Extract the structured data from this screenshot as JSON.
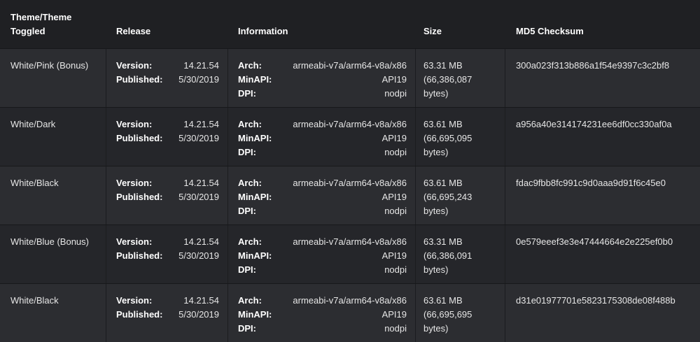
{
  "headers": {
    "theme": "Theme/Theme Toggled",
    "release": "Release",
    "information": "Information",
    "size": "Size",
    "md5": "MD5 Checksum"
  },
  "labels": {
    "version": "Version:",
    "published": "Published:",
    "arch": "Arch:",
    "minapi": "MinAPI:",
    "dpi": "DPI:"
  },
  "rows": [
    {
      "theme": "White/Pink (Bonus)",
      "version": "14.21.54",
      "published": "5/30/2019",
      "arch": "armeabi-v7a/arm64-v8a/x86",
      "minapi": "API19",
      "dpi": "nodpi",
      "size_mb": "63.31 MB",
      "size_bytes_1": "(66,386,087",
      "size_bytes_2": "bytes)",
      "md5": "300a023f313b886a1f54e9397c3c2bf8"
    },
    {
      "theme": "White/Dark",
      "version": "14.21.54",
      "published": "5/30/2019",
      "arch": "armeabi-v7a/arm64-v8a/x86",
      "minapi": "API19",
      "dpi": "nodpi",
      "size_mb": "63.61 MB",
      "size_bytes_1": "(66,695,095",
      "size_bytes_2": "bytes)",
      "md5": "a956a40e314174231ee6df0cc330af0a"
    },
    {
      "theme": "White/Black",
      "version": "14.21.54",
      "published": "5/30/2019",
      "arch": "armeabi-v7a/arm64-v8a/x86",
      "minapi": "API19",
      "dpi": "nodpi",
      "size_mb": "63.61 MB",
      "size_bytes_1": "(66,695,243",
      "size_bytes_2": "bytes)",
      "md5": "fdac9fbb8fc991c9d0aaa9d91f6c45e0"
    },
    {
      "theme": "White/Blue (Bonus)",
      "version": "14.21.54",
      "published": "5/30/2019",
      "arch": "armeabi-v7a/arm64-v8a/x86",
      "minapi": "API19",
      "dpi": "nodpi",
      "size_mb": "63.31 MB",
      "size_bytes_1": "(66,386,091",
      "size_bytes_2": "bytes)",
      "md5": "0e579eeef3e3e47444664e2e225ef0b0"
    },
    {
      "theme": "White/Black",
      "version": "14.21.54",
      "published": "5/30/2019",
      "arch": "armeabi-v7a/arm64-v8a/x86",
      "minapi": "API19",
      "dpi": "nodpi",
      "size_mb": "63.61 MB",
      "size_bytes_1": "(66,695,695",
      "size_bytes_2": "bytes)",
      "md5": "d31e01977701e5823175308de08f488b"
    }
  ],
  "colors": {
    "background": "#1f2023",
    "row_odd": "#2c2d31",
    "row_even": "#25262a",
    "text": "#e6e6e6",
    "header_text": "#ffffff"
  }
}
